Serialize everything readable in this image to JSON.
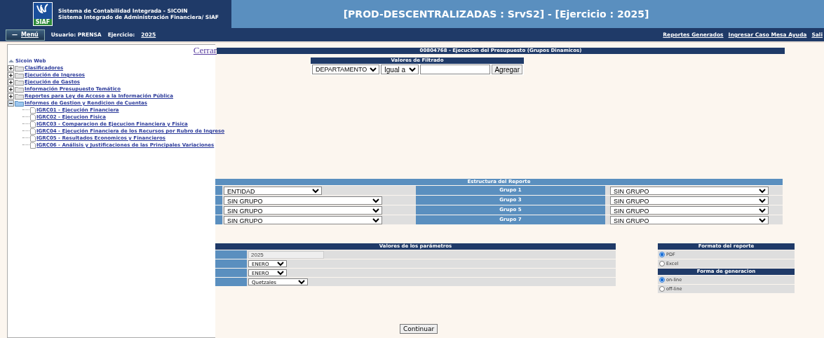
{
  "header": {
    "logo_text": "SIAF",
    "line1": "Sistema de Contabilidad Integrada - SICOIN",
    "line2": "Sistema Integrado de Administración Financiera/ SIAF",
    "title": "[PROD-DESCENTRALIZADAS : SrvS2] - [Ejercicio : 2025]"
  },
  "menubar": {
    "menu_icon": "—",
    "menu_button": "Menú",
    "user_label": "Usuario: PRENSA",
    "year_label": "Ejercicio:",
    "year": "2025",
    "links": [
      "Reportes Generados",
      "Ingresar Caso Mesa Ayuda",
      "Sali"
    ]
  },
  "tree": {
    "close_link": "Cerrar",
    "root": "Sicoin Web",
    "items": [
      {
        "label": "Clasificadores",
        "expanded": false
      },
      {
        "label": "Ejecución de Ingresos",
        "expanded": false
      },
      {
        "label": "Ejecución de Gastos",
        "expanded": false
      },
      {
        "label": "Información Presupuesto Temático",
        "expanded": false
      },
      {
        "label": "Reportes para Ley de Acceso a la Información Pública",
        "expanded": false
      },
      {
        "label": "Informes de Gestion y Rendicion de Cuentas",
        "expanded": true,
        "children": [
          {
            "label": "IGRC01 - Ejecución Financiera"
          },
          {
            "label": "IGRC02 - Ejecucion Fisica"
          },
          {
            "label": "IGRC03 - Comparacion de Ejecucion Financiera y Fisica"
          },
          {
            "label": "IGRC04 - Ejecución Financiera de los Recursos por Rubro de Ingreso"
          },
          {
            "label": "IGRC05 - Resultados Economicos y Financieros"
          },
          {
            "label": "IGRC06 - Análisis y Justificaciones de las Principales Variaciones"
          }
        ]
      }
    ]
  },
  "report": {
    "title": "00804768 - Ejecucion del Presupuesto (Grupos Dinamicos)",
    "filter": {
      "heading": "Valores de Filtrado",
      "field": "DEPARTAMENTO",
      "operator": "Igual a",
      "button": "Agregar"
    },
    "structure": {
      "heading": "Estructura del Reporte",
      "rows": [
        {
          "left": "ENTIDAD",
          "group_label": "Grupo 1",
          "right": "SIN GRUPO"
        },
        {
          "left": "SIN GRUPO",
          "group_label": "Grupo 3",
          "right": "SIN GRUPO"
        },
        {
          "left": "SIN GRUPO",
          "group_label": "Grupo 5",
          "right": "SIN GRUPO"
        },
        {
          "left": "SIN GRUPO",
          "group_label": "Grupo 7",
          "right": "SIN GRUPO"
        }
      ]
    },
    "parameters": {
      "heading": "Valores de los parámetros",
      "rows": [
        {
          "kind": "readonly",
          "value": "2025"
        },
        {
          "kind": "select",
          "value": "ENERO"
        },
        {
          "kind": "select",
          "value": "ENERO"
        },
        {
          "kind": "select",
          "value": "Quetzales"
        }
      ]
    },
    "format": {
      "heading": "Formato del reporte",
      "options": [
        {
          "label": "PDF",
          "selected": true
        },
        {
          "label": "Excel",
          "selected": false
        }
      ]
    },
    "generation": {
      "heading": "Forma de generacion",
      "options": [
        {
          "label": "on-line",
          "selected": true
        },
        {
          "label": "off-line",
          "selected": false
        }
      ]
    },
    "continue_button": "Continuar"
  }
}
